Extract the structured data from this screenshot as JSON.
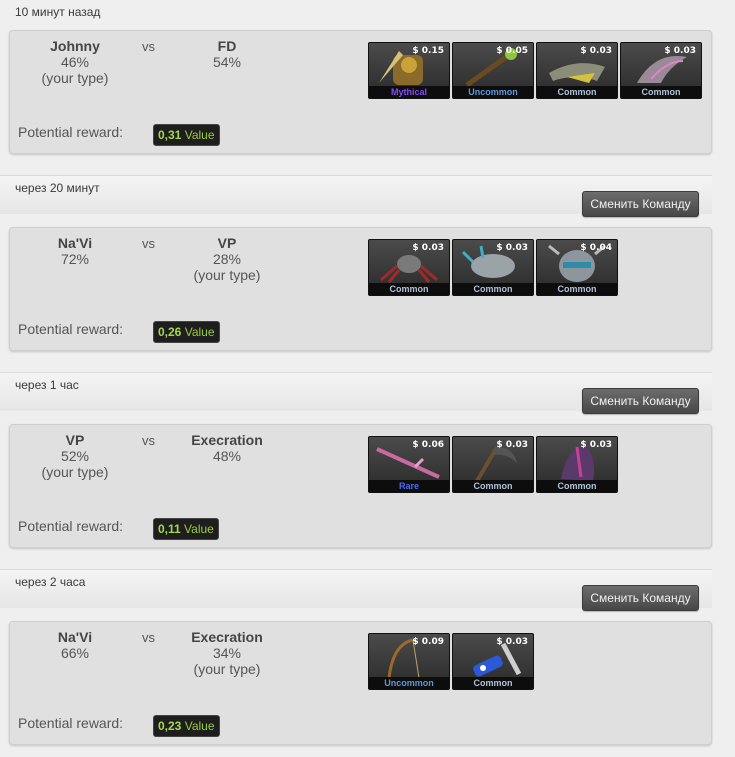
{
  "matches": [
    {
      "time": "10 минут назад",
      "team_a": {
        "name": "Johnny",
        "pct": "46%",
        "your_type": "(your type)"
      },
      "vs": "vs",
      "team_b": {
        "name": "FD",
        "pct": "54%",
        "your_type": ""
      },
      "reward_label": "Potential reward:",
      "reward_value": "0,31",
      "reward_unit": "Value",
      "items": [
        {
          "price": "$ 0.15",
          "rarity": "Mythical",
          "rarity_color": "#8847ff",
          "icon": "hero-figure-icon"
        },
        {
          "price": "$ 0.05",
          "rarity": "Uncommon",
          "rarity_color": "#5e98d9",
          "icon": "staff-icon"
        },
        {
          "price": "$ 0.03",
          "rarity": "Common",
          "rarity_color": "#b0c3d9",
          "icon": "armor-icon"
        },
        {
          "price": "$ 0.03",
          "rarity": "Common",
          "rarity_color": "#b0c3d9",
          "icon": "wing-icon"
        }
      ]
    },
    {
      "time": "через 20 минут",
      "button": "Сменить Команду",
      "team_a": {
        "name": "Na'Vi",
        "pct": "72%",
        "your_type": ""
      },
      "vs": "vs",
      "team_b": {
        "name": "VP",
        "pct": "28%",
        "your_type": "(your type)"
      },
      "reward_label": "Potential reward:",
      "reward_value": "0,26",
      "reward_unit": "Value",
      "items": [
        {
          "price": "$ 0.03",
          "rarity": "Common",
          "rarity_color": "#b0c3d9",
          "icon": "spider-icon"
        },
        {
          "price": "$ 0.03",
          "rarity": "Common",
          "rarity_color": "#b0c3d9",
          "icon": "creature-icon"
        },
        {
          "price": "$ 0.04",
          "rarity": "Common",
          "rarity_color": "#b0c3d9",
          "icon": "mask-icon"
        }
      ]
    },
    {
      "time": "через 1 час",
      "button": "Сменить Команду",
      "team_a": {
        "name": "VP",
        "pct": "52%",
        "your_type": "(your type)"
      },
      "vs": "vs",
      "team_b": {
        "name": "Execration",
        "pct": "48%",
        "your_type": ""
      },
      "reward_label": "Potential reward:",
      "reward_value": "0,11",
      "reward_unit": "Value",
      "items": [
        {
          "price": "$ 0.06",
          "rarity": "Rare",
          "rarity_color": "#4b69ff",
          "icon": "sword-icon"
        },
        {
          "price": "$ 0.03",
          "rarity": "Common",
          "rarity_color": "#b0c3d9",
          "icon": "scythe-icon"
        },
        {
          "price": "$ 0.03",
          "rarity": "Common",
          "rarity_color": "#b0c3d9",
          "icon": "cloak-icon"
        }
      ]
    },
    {
      "time": "через 2 часа",
      "button": "Сменить Команду",
      "team_a": {
        "name": "Na'Vi",
        "pct": "66%",
        "your_type": ""
      },
      "vs": "vs",
      "team_b": {
        "name": "Execration",
        "pct": "34%",
        "your_type": "(your type)"
      },
      "reward_label": "Potential reward:",
      "reward_value": "0,23",
      "reward_unit": "Value",
      "items": [
        {
          "price": "$ 0.09",
          "rarity": "Uncommon",
          "rarity_color": "#5e98d9",
          "icon": "bow-icon"
        },
        {
          "price": "$ 0.03",
          "rarity": "Common",
          "rarity_color": "#b0c3d9",
          "icon": "gem-icon"
        }
      ]
    }
  ]
}
